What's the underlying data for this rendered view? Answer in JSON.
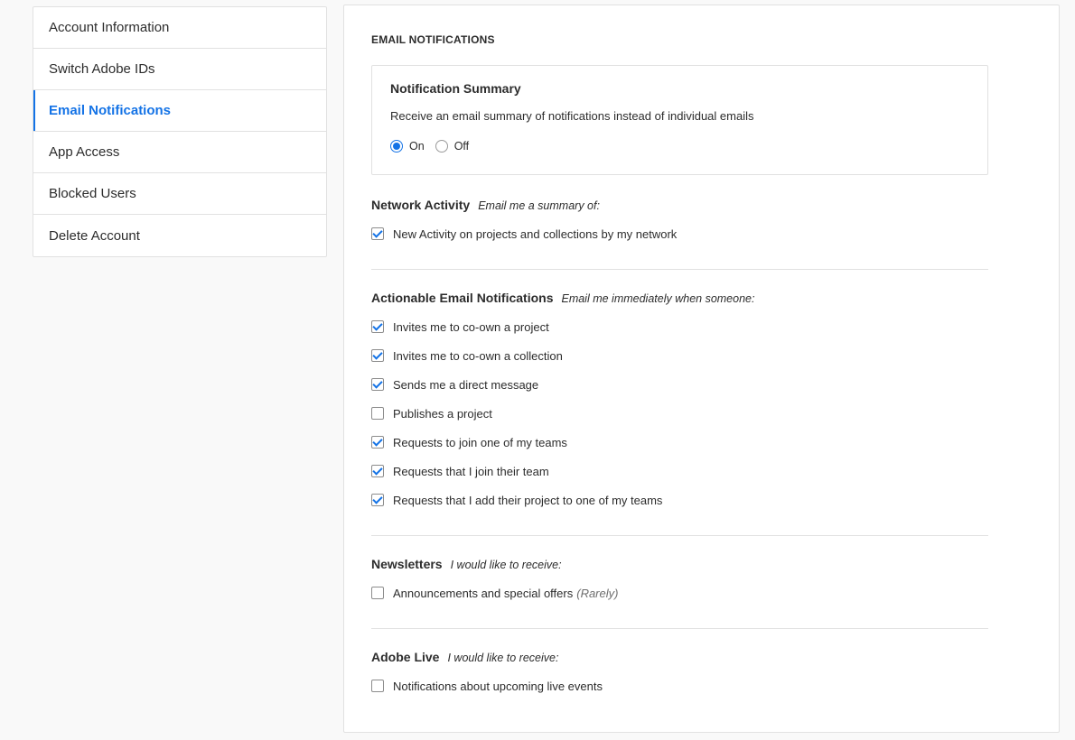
{
  "sidebar": {
    "items": [
      {
        "label": "Account Information"
      },
      {
        "label": "Switch Adobe IDs"
      },
      {
        "label": "Email Notifications",
        "active": true
      },
      {
        "label": "App Access"
      },
      {
        "label": "Blocked Users"
      },
      {
        "label": "Delete Account"
      }
    ]
  },
  "page": {
    "title": "EMAIL NOTIFICATIONS"
  },
  "summary": {
    "title": "Notification Summary",
    "description": "Receive an email summary of notifications instead of individual emails",
    "on_label": "On",
    "off_label": "Off",
    "selected": "On"
  },
  "network": {
    "title": "Network Activity",
    "subtitle": "Email me a summary of:",
    "items": [
      {
        "label": "New Activity on projects and collections by my network",
        "checked": true
      }
    ]
  },
  "actionable": {
    "title": "Actionable Email Notifications",
    "subtitle": "Email me immediately when someone:",
    "items": [
      {
        "label": "Invites me to co-own a project",
        "checked": true
      },
      {
        "label": "Invites me to co-own a collection",
        "checked": true
      },
      {
        "label": "Sends me a direct message",
        "checked": true
      },
      {
        "label": "Publishes a project",
        "checked": false
      },
      {
        "label": "Requests to join one of my teams",
        "checked": true
      },
      {
        "label": "Requests that I join their team",
        "checked": true
      },
      {
        "label": "Requests that I add their project to one of my teams",
        "checked": true
      }
    ]
  },
  "newsletters": {
    "title": "Newsletters",
    "subtitle": "I would like to receive:",
    "items": [
      {
        "label": "Announcements and special offers",
        "hint": "(Rarely)",
        "checked": false
      }
    ]
  },
  "adobe_live": {
    "title": "Adobe Live",
    "subtitle": "I would like to receive:",
    "items": [
      {
        "label": "Notifications about upcoming live events",
        "checked": false
      }
    ]
  },
  "colors": {
    "accent": "#1473e6",
    "text": "#2c2c2c",
    "border": "#e1e1e1",
    "background": "#f9f9f9"
  }
}
